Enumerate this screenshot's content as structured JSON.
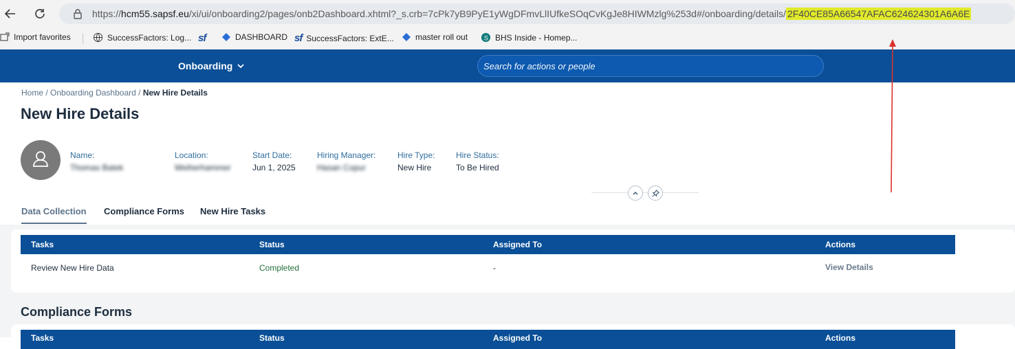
{
  "browser": {
    "url_prefix": "https://",
    "url_host": "hcm55.sapsf.eu",
    "url_path": "/xi/ui/onboarding2/pages/onb2Dashboard.xhtml?_s.crb=7cPk7yB9PyE1yWgDFmvLlIUfkeSOqCvKgJe8HIWMzlg%253d#/onboarding/details/",
    "url_highlight": "2F40CE85A66547AFAC624624301A6A6E",
    "favorites": [
      {
        "label": "Import favorites",
        "icon": "import-icon"
      },
      {
        "label": "SuccessFactors: Log...",
        "icon": "globe-icon"
      },
      {
        "label": "DASHBOARD",
        "icon": "sf-logo-icon"
      },
      {
        "label": "SuccessFactors: ExtE...",
        "icon": "jira-icon"
      },
      {
        "label": "master roll out",
        "icon": "jira-icon"
      },
      {
        "label": "BHS Inside - Homep...",
        "icon": "sharepoint-icon"
      }
    ],
    "sf_mark": "sf"
  },
  "shell": {
    "module": "Onboarding",
    "search_placeholder": "Search for actions or people"
  },
  "breadcrumb": {
    "home": "Home",
    "sep": "/",
    "dashboard": "Onboarding Dashboard",
    "current": "New Hire Details"
  },
  "page_title": "New Hire Details",
  "header_attributes": [
    {
      "label": "Name:",
      "value": "Thomas Batek"
    },
    {
      "label": "Location:",
      "value": "Weiherhammer"
    },
    {
      "label": "Start Date:",
      "value": "Jun 1, 2025"
    },
    {
      "label": "Hiring Manager:",
      "value": "Hasan Copur"
    },
    {
      "label": "Hire Type:",
      "value": "New Hire"
    },
    {
      "label": "Hire Status:",
      "value": "To Be Hired"
    }
  ],
  "tabs": [
    "Data Collection",
    "Compliance Forms",
    "New Hire Tasks"
  ],
  "table": {
    "headers": [
      "Tasks",
      "Status",
      "Assigned To",
      "Actions"
    ],
    "rows": [
      {
        "task": "Review New Hire Data",
        "status": "Completed",
        "assigned": "-",
        "action": "View Details"
      }
    ]
  },
  "compliance": {
    "title": "Compliance Forms"
  },
  "colors": {
    "shell": "#0a4f97",
    "highlight": "#e1ea2a",
    "annotation_arrow": "#d9322b"
  }
}
